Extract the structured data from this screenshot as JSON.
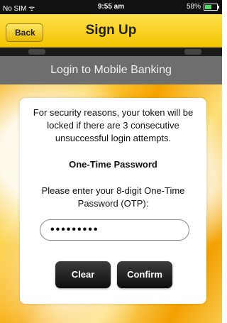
{
  "statusbar": {
    "carrier": "No SIM",
    "time": "9:55 am",
    "battery": "58%",
    "battery_level": 0.58
  },
  "navbar": {
    "back_label": "Back",
    "title": "Sign Up"
  },
  "section": {
    "title": "Login to Mobile Banking"
  },
  "card": {
    "security_message": "For security reasons, your token will be locked if there are 3 consecutive unsuccessful login attempts.",
    "otp_title": "One-Time Password",
    "otp_instruction": "Please enter your 8-digit One-Time Password (OTP):",
    "otp_value": "•••••••••"
  },
  "buttons": {
    "clear_label": "Clear",
    "confirm_label": "Confirm"
  },
  "colors": {
    "navbar_yellow": "#f3c400",
    "header_grey": "#6e6e6e",
    "button_black": "#0e0e0e"
  }
}
